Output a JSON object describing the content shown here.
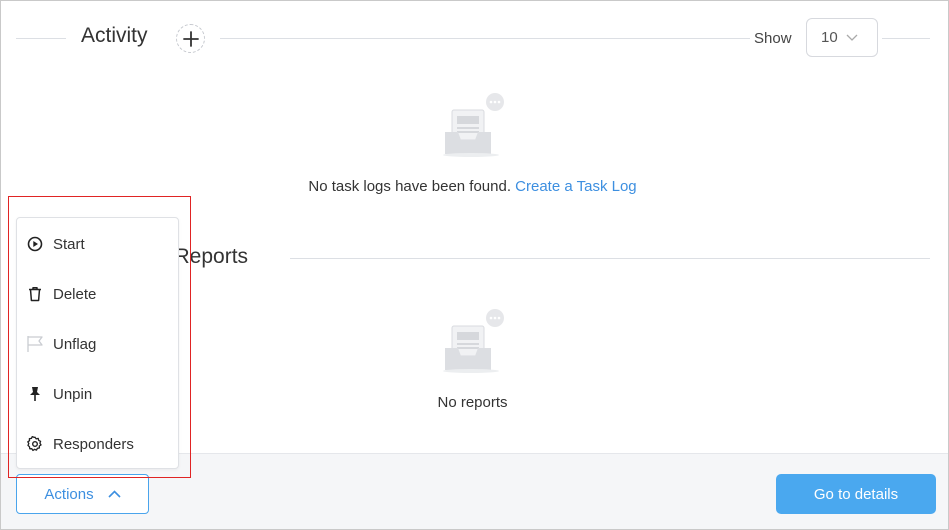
{
  "activity": {
    "title": "Activity",
    "show_label": "Show",
    "show_value": "10"
  },
  "task_logs": {
    "empty_text": "No task logs have been found.",
    "create_link": "Create a Task Log"
  },
  "reports": {
    "title_visible": "er Reports",
    "empty_text": "No reports"
  },
  "actions_menu": {
    "items": [
      {
        "label": "Start",
        "icon": "play-circle-icon"
      },
      {
        "label": "Delete",
        "icon": "trash-icon"
      },
      {
        "label": "Unflag",
        "icon": "flag-icon"
      },
      {
        "label": "Unpin",
        "icon": "pin-icon"
      },
      {
        "label": "Responders",
        "icon": "gear-icon"
      }
    ]
  },
  "footer": {
    "actions_label": "Actions",
    "details_label": "Go to details"
  },
  "colors": {
    "accent": "#4aa8ef",
    "link": "#3d8fe0",
    "highlight": "#e02424"
  }
}
